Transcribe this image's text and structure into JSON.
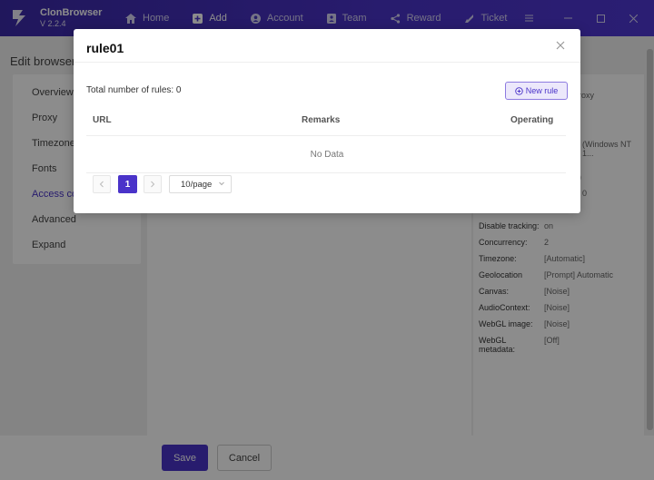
{
  "app": {
    "name": "ClonBrowser",
    "version": "V 2.2.4"
  },
  "nav": {
    "items": [
      {
        "label": "Home",
        "icon": "home-icon",
        "active": false
      },
      {
        "label": "Add",
        "icon": "add-icon",
        "active": true
      },
      {
        "label": "Account",
        "icon": "account-icon",
        "active": false
      },
      {
        "label": "Team",
        "icon": "team-icon",
        "active": false
      },
      {
        "label": "Reward",
        "icon": "share-icon",
        "active": false
      },
      {
        "label": "Ticket",
        "icon": "ticket-icon",
        "active": false
      }
    ]
  },
  "page": {
    "title": "Edit browser"
  },
  "side_menu": {
    "items": [
      {
        "label": "Overview"
      },
      {
        "label": "Proxy"
      },
      {
        "label": "Timezone&"
      },
      {
        "label": "Fonts"
      },
      {
        "label": "Access co"
      },
      {
        "label": "Advanced"
      },
      {
        "label": "Expand"
      }
    ]
  },
  "summary": {
    "partial_proxy": "roxy",
    "partial_ua": "(Windows NT 1...",
    "partial_a": ")",
    "partial_b": "0",
    "rows": [
      {
        "key": "Disable tracking:",
        "value": "on"
      },
      {
        "key": "Concurrency:",
        "value": "2"
      },
      {
        "key": "Timezone:",
        "value": "[Automatic]"
      },
      {
        "key": "Geolocation",
        "value": "[Prompt] Automatic"
      },
      {
        "key": "Canvas:",
        "value": "[Noise]"
      },
      {
        "key": "AudioContext:",
        "value": "[Noise]"
      },
      {
        "key": "WebGL image:",
        "value": "[Noise]"
      },
      {
        "key": "WebGL metadata:",
        "value": "[Off]"
      }
    ]
  },
  "footer": {
    "save_label": "Save",
    "cancel_label": "Cancel"
  },
  "modal": {
    "title": "rule01",
    "total_text": "Total number of rules: 0",
    "new_rule_label": "New rule",
    "columns": {
      "url": "URL",
      "remarks": "Remarks",
      "operating": "Operating"
    },
    "empty_text": "No Data",
    "pagination": {
      "current_page": "1",
      "page_size": "10/page"
    }
  },
  "colors": {
    "brand": "#4a33c9",
    "header_start": "#3b2aa8",
    "header_end": "#4f37d2"
  }
}
